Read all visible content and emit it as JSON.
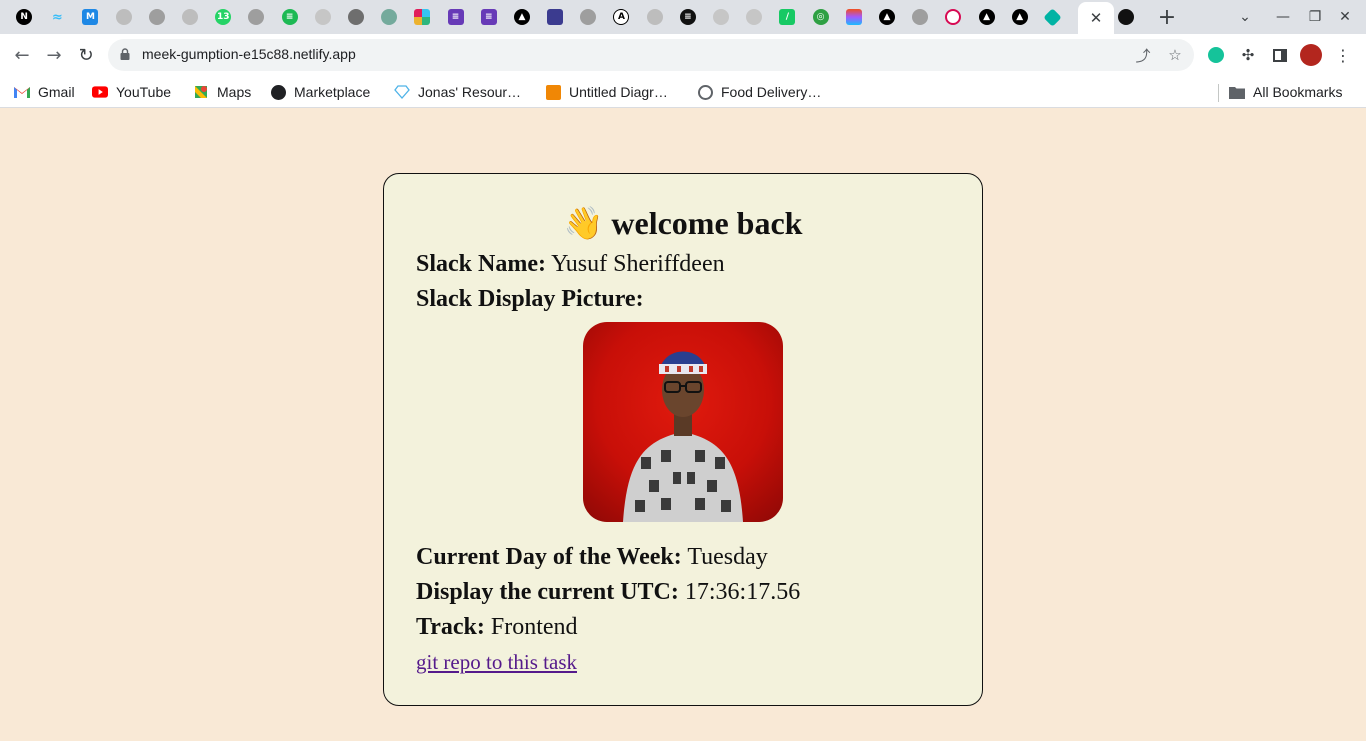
{
  "browser": {
    "url": "meek-gumption-e15c88.netlify.app",
    "active_tab_close": "✕",
    "new_tab": "+",
    "bookmarks": [
      {
        "label": "Gmail",
        "icon": "gmail-icon"
      },
      {
        "label": "YouTube",
        "icon": "youtube-icon"
      },
      {
        "label": "Maps",
        "icon": "maps-icon"
      },
      {
        "label": "Marketplace",
        "icon": "marketplace-icon"
      },
      {
        "label": "Jonas' Resour…",
        "icon": "diamond-icon"
      },
      {
        "label": "Untitled Diagr…",
        "icon": "drawio-icon"
      },
      {
        "label": "Food Delivery…",
        "icon": "openai-icon"
      }
    ],
    "all_bookmarks": "All Bookmarks"
  },
  "card": {
    "welcome_emoji": "👋",
    "welcome_text": "welcome back",
    "slack_name_label": "Slack Name:",
    "slack_name_value": "Yusuf Sheriffdeen",
    "display_picture_label": "Slack Display Picture:",
    "day_label": "Current Day of the Week:",
    "day_value": "Tuesday",
    "utc_label": "Display the current UTC:",
    "utc_value": "17:36:17.56",
    "track_label": "Track:",
    "track_value": "Frontend",
    "repo_link": "git repo to this task"
  },
  "colors": {
    "page_bg": "#f9e9d6",
    "card_bg": "#f3f2dc",
    "link": "#551a8b",
    "photo_bg": "#d0120a"
  }
}
